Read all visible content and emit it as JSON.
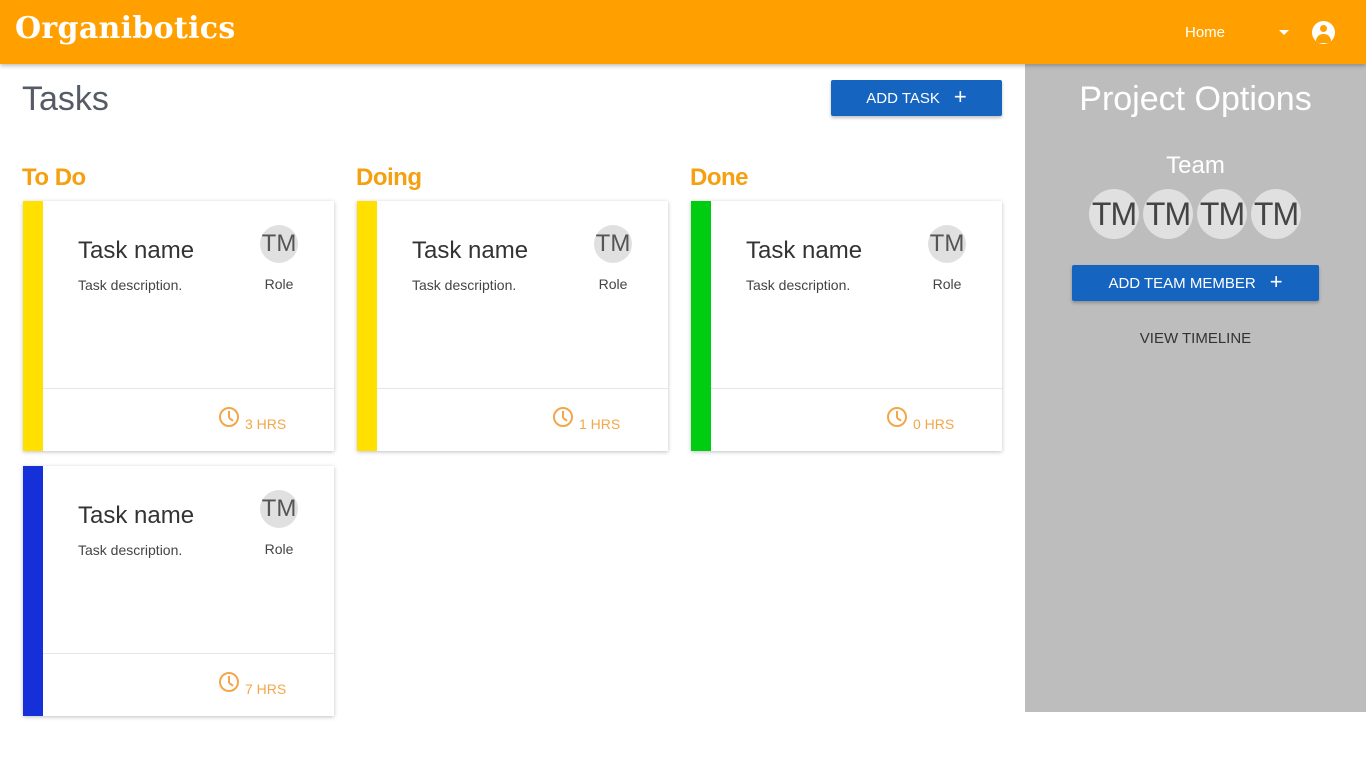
{
  "header": {
    "brand": "Organibotics",
    "nav_home": "Home"
  },
  "tasks": {
    "title": "Tasks",
    "add_label": "ADD TASK",
    "plus": "+"
  },
  "columns": [
    {
      "title": "To Do"
    },
    {
      "title": "Doing"
    },
    {
      "title": "Done"
    }
  ],
  "cards": [
    {
      "name": "Task name",
      "description": "Task description.",
      "initials": "TM",
      "role": "Role",
      "hours": "3 HRS",
      "color": "#ffe000"
    },
    {
      "name": "Task name",
      "description": "Task description.",
      "initials": "TM",
      "role": "Role",
      "hours": "1 HRS",
      "color": "#ffe000"
    },
    {
      "name": "Task name",
      "description": "Task description.",
      "initials": "TM",
      "role": "Role",
      "hours": "0 HRS",
      "color": "#00cc11"
    },
    {
      "name": "Task name",
      "description": "Task description.",
      "initials": "TM",
      "role": "Role",
      "hours": "7 HRS",
      "color": "#1530d8"
    }
  ],
  "sidebar": {
    "title": "Project Options",
    "team_label": "Team",
    "members": [
      "TM",
      "TM",
      "TM",
      "TM"
    ],
    "add_member_label": "ADD TEAM MEMBER",
    "plus": "+",
    "view_timeline": "VIEW TIMELINE"
  },
  "colors": {
    "header": "#ffa000",
    "accent": "#f5a010",
    "button": "#1565c0",
    "sidebar": "#bdbdbd"
  },
  "icons": {
    "account": "account-circle-icon",
    "dropdown": "caret-down-icon",
    "clock": "clock-icon",
    "add": "plus-icon"
  }
}
